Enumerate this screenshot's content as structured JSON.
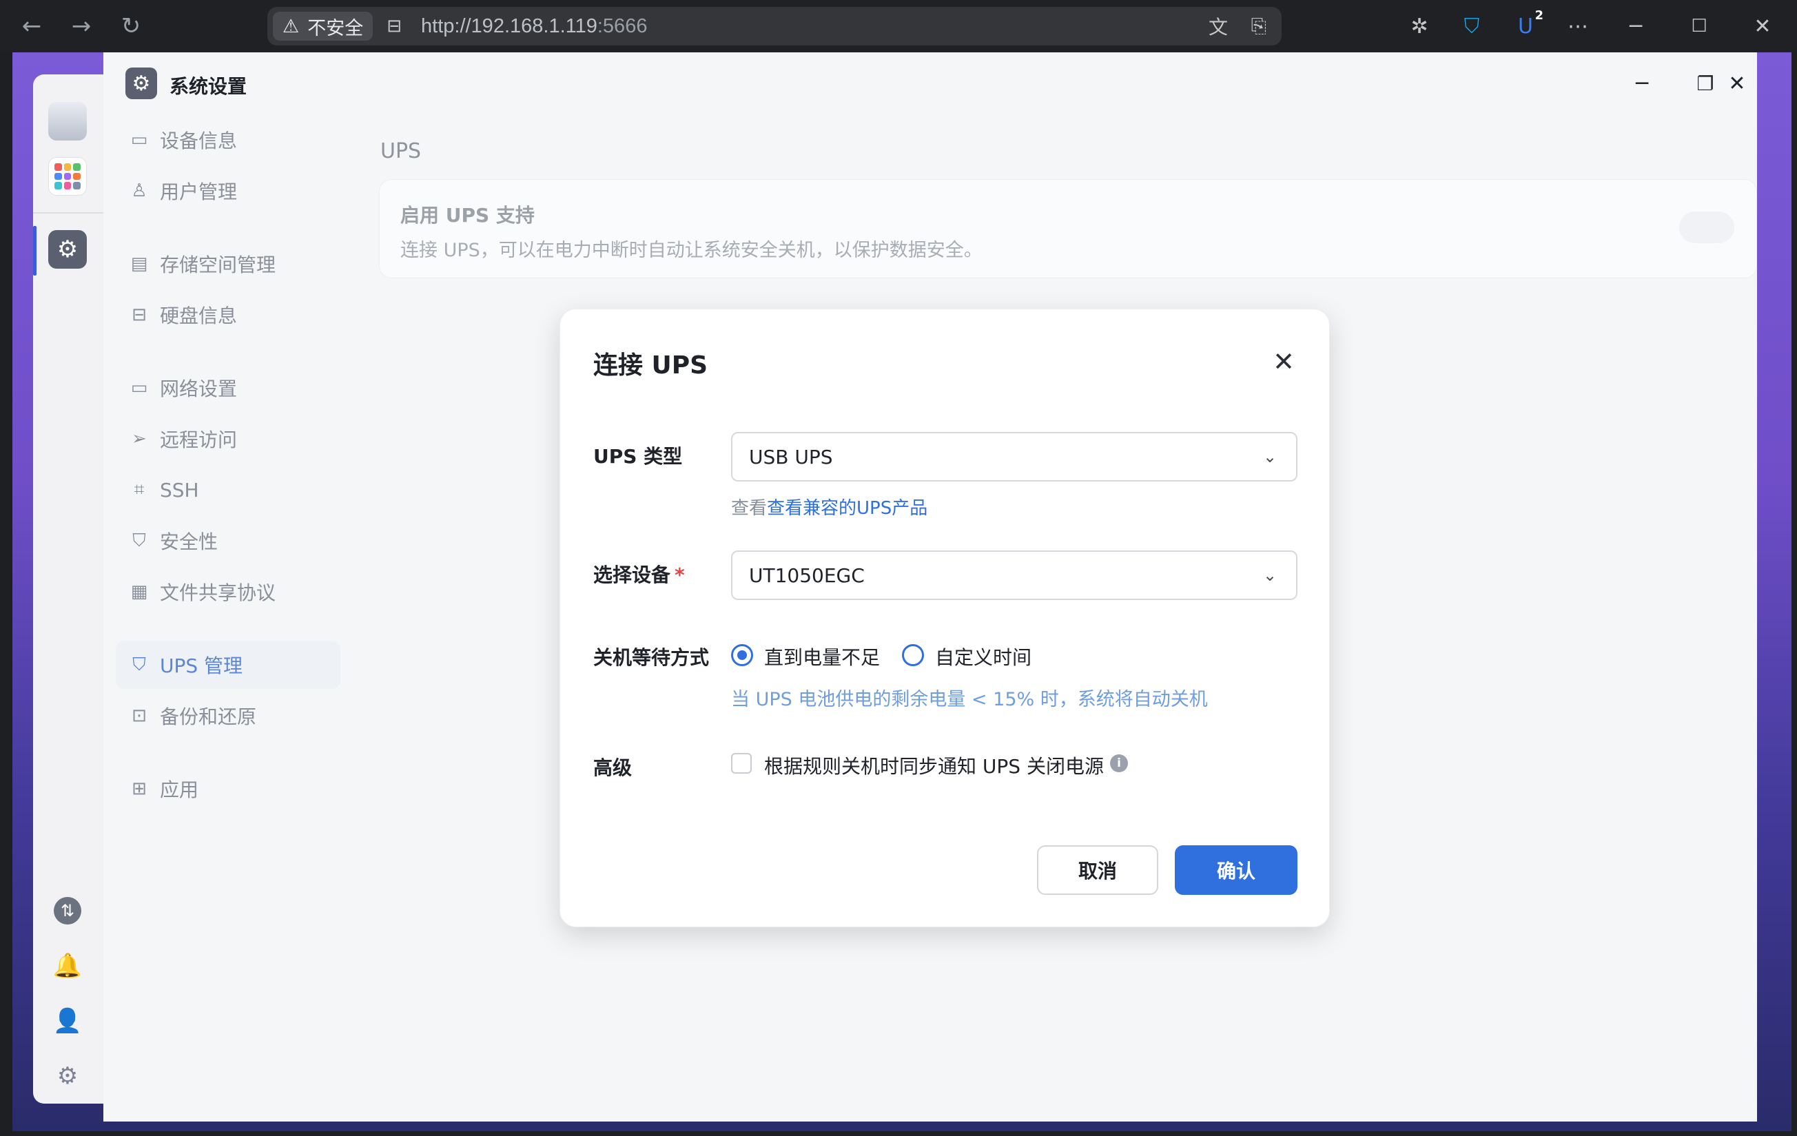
{
  "browser": {
    "security_label": "不安全",
    "url_host": "http://192.168.1.119",
    "url_port": ":5666",
    "extension_badge": "2"
  },
  "window": {
    "title": "系统设置"
  },
  "sidebar": {
    "items": [
      {
        "label": "设备信息",
        "icon": "device-info-icon"
      },
      {
        "label": "用户管理",
        "icon": "user-icon"
      },
      {
        "label": "存储空间管理",
        "icon": "storage-icon"
      },
      {
        "label": "硬盘信息",
        "icon": "disk-icon"
      },
      {
        "label": "网络设置",
        "icon": "network-icon"
      },
      {
        "label": "远程访问",
        "icon": "send-icon"
      },
      {
        "label": "SSH",
        "icon": "code-icon"
      },
      {
        "label": "安全性",
        "icon": "shield-icon"
      },
      {
        "label": "文件共享协议",
        "icon": "file-icon"
      },
      {
        "label": "UPS 管理",
        "icon": "ups-shield-icon"
      },
      {
        "label": "备份和还原",
        "icon": "backup-icon"
      },
      {
        "label": "应用",
        "icon": "apps-icon"
      }
    ],
    "active": "UPS 管理"
  },
  "content": {
    "title": "UPS",
    "card_heading": "启用 UPS 支持",
    "card_desc": "连接 UPS，可以在电力中断时自动让系统安全关机，以保护数据安全。"
  },
  "dialog": {
    "title": "连接 UPS",
    "ups_type_label": "UPS 类型",
    "ups_type_value": "USB UPS",
    "compat_prefix": "查看",
    "compat_link": "查看兼容的UPS产品",
    "device_label": "选择设备",
    "device_required": "*",
    "device_value": "UT1050EGC",
    "shutdown_label": "关机等待方式",
    "option_low_battery": "直到电量不足",
    "option_custom_time": "自定义时间",
    "shutdown_hint": "当 UPS 电池供电的剩余电量 < 15% 时，系统将自动关机",
    "advanced_label": "高级",
    "advanced_checkbox": "根据规则关机时同步通知 UPS 关闭电源",
    "cancel": "取消",
    "confirm": "确认"
  },
  "colors": {
    "accent": "#2f6fde",
    "required": "#e54545",
    "dock_active": "#3b5bdb"
  }
}
